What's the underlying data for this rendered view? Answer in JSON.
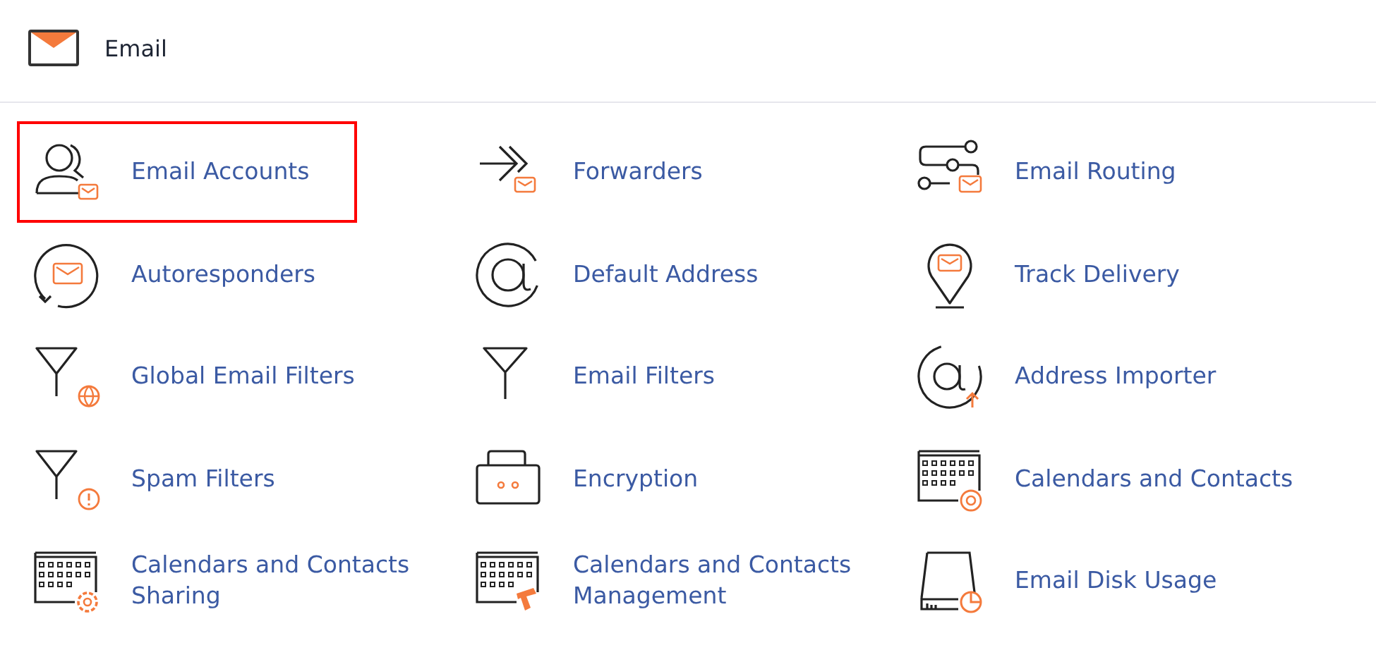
{
  "header": {
    "title": "Email"
  },
  "items": [
    {
      "label": "Email Accounts",
      "kind": "accounts",
      "highlighted": true
    },
    {
      "label": "Forwarders",
      "kind": "forwarders",
      "highlighted": false
    },
    {
      "label": "Email Routing",
      "kind": "routing",
      "highlighted": false
    },
    {
      "label": "Autoresponders",
      "kind": "autoresponders",
      "highlighted": false
    },
    {
      "label": "Default Address",
      "kind": "at",
      "highlighted": false
    },
    {
      "label": "Track Delivery",
      "kind": "track",
      "highlighted": false
    },
    {
      "label": "Global Email Filters",
      "kind": "globalfilter",
      "highlighted": false
    },
    {
      "label": "Email Filters",
      "kind": "filter",
      "highlighted": false
    },
    {
      "label": "Address Importer",
      "kind": "importer",
      "highlighted": false
    },
    {
      "label": "Spam Filters",
      "kind": "spamfilter",
      "highlighted": false
    },
    {
      "label": "Encryption",
      "kind": "encryption",
      "highlighted": false
    },
    {
      "label": "Calendars and Contacts",
      "kind": "calendarat",
      "highlighted": false
    },
    {
      "label": "Calendars and Contacts Sharing",
      "kind": "calendargear",
      "highlighted": false
    },
    {
      "label": "Calendars and Contacts Management",
      "kind": "calendartool",
      "highlighted": false
    },
    {
      "label": "Email Disk Usage",
      "kind": "disk",
      "highlighted": false
    }
  ]
}
